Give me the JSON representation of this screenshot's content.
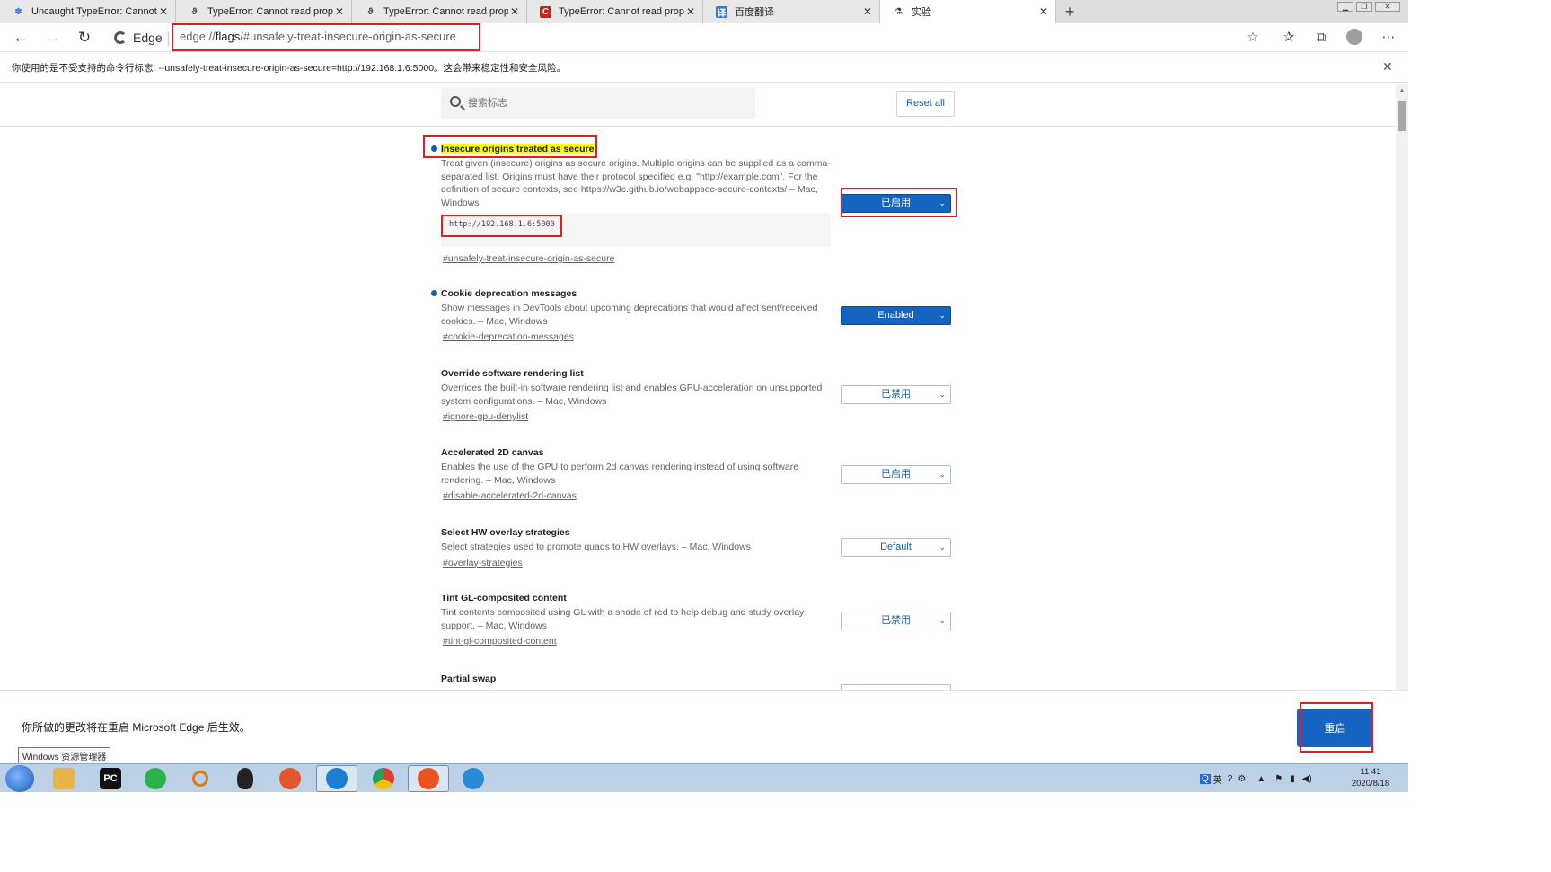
{
  "tabs": [
    {
      "title": "Uncaught TypeError: Cannot rea",
      "favicon": "paw-icon",
      "color": "#2a6ad8"
    },
    {
      "title": "TypeError: Cannot read property",
      "favicon": "feather-icon",
      "color": "#444444"
    },
    {
      "title": "TypeError: Cannot read property",
      "favicon": "feather-icon",
      "color": "#444444"
    },
    {
      "title": "TypeError: Cannot read property",
      "favicon": "c-icon",
      "color": "#d01e1e"
    },
    {
      "title": "百度翻译",
      "favicon": "translate-icon",
      "color": "#2a7ae2"
    },
    {
      "title": "实验",
      "favicon": "flask-icon",
      "color": "#333333"
    }
  ],
  "toolbar": {
    "identity_label": "Edge",
    "url_scheme": "edge://",
    "url_host": "flags",
    "url_path": "/#unsafely-treat-insecure-origin-as-secure"
  },
  "infobar": {
    "text": "你使用的是不受支持的命令行标志: --unsafely-treat-insecure-origin-as-secure=http://192.168.1.6:5000。这会带来稳定性和安全风险。"
  },
  "header": {
    "search_placeholder": "搜索标志",
    "reset_label": "Reset all"
  },
  "experiments": [
    {
      "title": "Insecure origins treated as secure",
      "desc": "Treat given (insecure) origins as secure origins. Multiple origins can be supplied as a comma-separated list. Origins must have their protocol specified e.g. \"http://example.com\". For the definition of secure contexts, see https://w3c.github.io/webappsec-secure-contexts/ – Mac, Windows",
      "origin_value": "http://192.168.1.6:5000",
      "link": "#unsafely-treat-insecure-origin-as-secure",
      "select": "已启用",
      "modified": true
    },
    {
      "title": "Cookie deprecation messages",
      "desc": "Show messages in DevTools about upcoming deprecations that would affect sent/received cookies. – Mac, Windows",
      "link": "#cookie-deprecation-messages",
      "select": "Enabled",
      "modified": true
    },
    {
      "title": "Override software rendering list",
      "desc": "Overrides the built-in software rendering list and enables GPU-acceleration on unsupported system configurations. – Mac, Windows",
      "link": "#ignore-gpu-denylist",
      "select": "已禁用",
      "modified": false
    },
    {
      "title": "Accelerated 2D canvas",
      "desc": "Enables the use of the GPU to perform 2d canvas rendering instead of using software rendering. – Mac, Windows",
      "link": "#disable-accelerated-2d-canvas",
      "select": "已启用",
      "modified": false
    },
    {
      "title": "Select HW overlay strategies",
      "desc": "Select strategies used to promote quads to HW overlays. – Mac, Windows",
      "link": "#overlay-strategies",
      "select": "Default",
      "modified": false
    },
    {
      "title": "Tint GL-composited content",
      "desc": "Tint contents composited using GL with a shade of red to help debug and study overlay support. – Mac, Windows",
      "link": "#tint-gl-composited-content",
      "select": "已禁用",
      "modified": false
    },
    {
      "title": "Partial swap",
      "desc": "",
      "link": "",
      "select": "",
      "modified": false
    }
  ],
  "relaunch": {
    "text": "你所做的更改将在重启 Microsoft Edge 后生效。",
    "button_label": "重启"
  },
  "tooltip": "Windows 资源管理器",
  "taskbar": {
    "apps": [
      {
        "name": "file-explorer-icon",
        "label": "",
        "color": "#e8b54a"
      },
      {
        "name": "pycharm-icon",
        "label": "PC",
        "color": "#111111"
      },
      {
        "name": "wechat-icon",
        "label": "",
        "color": "#2bb24c"
      },
      {
        "name": "search-tool-icon",
        "label": "",
        "color": "#e07b1a"
      },
      {
        "name": "qq-icon",
        "label": "",
        "color": "#222222"
      },
      {
        "name": "firefox-icon",
        "label": "",
        "color": "#e2572b"
      },
      {
        "name": "edge-icon",
        "label": "",
        "color": "#1b7ed4"
      },
      {
        "name": "chrome-icon",
        "label": "",
        "color": "#dc3d2e"
      },
      {
        "name": "ubuntu-icon",
        "label": "",
        "color": "#e95420"
      },
      {
        "name": "edge-beta-icon",
        "label": "",
        "color": "#2a8ad6"
      }
    ],
    "tray_lang": "英",
    "time": "11:41",
    "date": "2020/8/18"
  }
}
